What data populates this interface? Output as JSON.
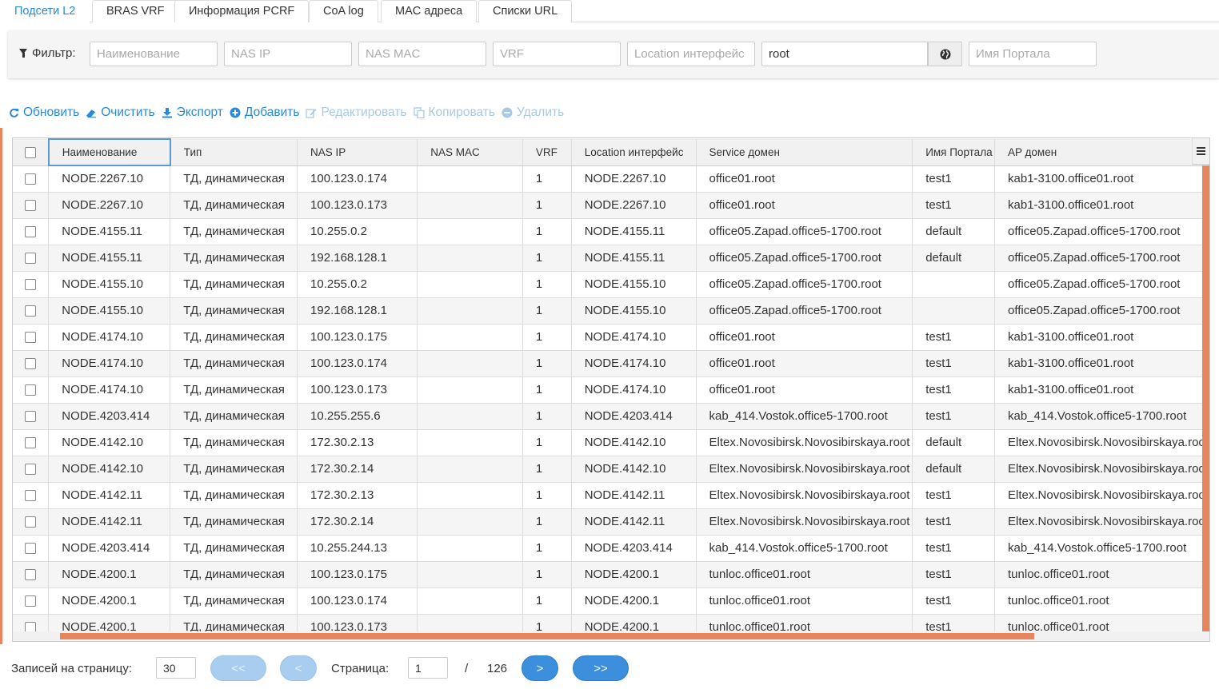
{
  "tabs": [
    {
      "label": "Подсети L2",
      "active": true
    },
    {
      "label": "BRAS VRF"
    },
    {
      "label": "Информация PCRF"
    },
    {
      "label": "CoA log"
    },
    {
      "label": "MAC адреса"
    },
    {
      "label": "Списки URL"
    }
  ],
  "filter": {
    "label": "Фильтр:",
    "name_placeholder": "Наименование",
    "nas_ip_placeholder": "NAS IP",
    "nas_mac_placeholder": "NAS MAC",
    "vrf_placeholder": "VRF",
    "location_placeholder": "Location интерфейс",
    "domain_value": "root",
    "portal_placeholder": "Имя Портала"
  },
  "toolbar": {
    "refresh": "Обновить",
    "clear": "Очистить",
    "export": "Экспорт",
    "add": "Добавить",
    "edit": "Редактировать",
    "copy": "Копировать",
    "delete": "Удалить"
  },
  "table": {
    "columns": [
      "Наименование",
      "Тип",
      "NAS IP",
      "NAS MAC",
      "VRF",
      "Location интерфейс",
      "Service домен",
      "Имя Портала",
      "AP домен"
    ],
    "rows": [
      [
        "NODE.2267.10",
        "ТД, динамическая",
        "100.123.0.174",
        "",
        "1",
        "NODE.2267.10",
        "office01.root",
        "test1",
        "kab1-3100.office01.root"
      ],
      [
        "NODE.2267.10",
        "ТД, динамическая",
        "100.123.0.173",
        "",
        "1",
        "NODE.2267.10",
        "office01.root",
        "test1",
        "kab1-3100.office01.root"
      ],
      [
        "NODE.4155.11",
        "ТД, динамическая",
        "10.255.0.2",
        "",
        "1",
        "NODE.4155.11",
        "office05.Zapad.office5-1700.root",
        "default",
        "office05.Zapad.office5-1700.root"
      ],
      [
        "NODE.4155.11",
        "ТД, динамическая",
        "192.168.128.1",
        "",
        "1",
        "NODE.4155.11",
        "office05.Zapad.office5-1700.root",
        "default",
        "office05.Zapad.office5-1700.root"
      ],
      [
        "NODE.4155.10",
        "ТД, динамическая",
        "10.255.0.2",
        "",
        "1",
        "NODE.4155.10",
        "office05.Zapad.office5-1700.root",
        "",
        "office05.Zapad.office5-1700.root"
      ],
      [
        "NODE.4155.10",
        "ТД, динамическая",
        "192.168.128.1",
        "",
        "1",
        "NODE.4155.10",
        "office05.Zapad.office5-1700.root",
        "",
        "office05.Zapad.office5-1700.root"
      ],
      [
        "NODE.4174.10",
        "ТД, динамическая",
        "100.123.0.175",
        "",
        "1",
        "NODE.4174.10",
        "office01.root",
        "test1",
        "kab1-3100.office01.root"
      ],
      [
        "NODE.4174.10",
        "ТД, динамическая",
        "100.123.0.174",
        "",
        "1",
        "NODE.4174.10",
        "office01.root",
        "test1",
        "kab1-3100.office01.root"
      ],
      [
        "NODE.4174.10",
        "ТД, динамическая",
        "100.123.0.173",
        "",
        "1",
        "NODE.4174.10",
        "office01.root",
        "test1",
        "kab1-3100.office01.root"
      ],
      [
        "NODE.4203.414",
        "ТД, динамическая",
        "10.255.255.6",
        "",
        "1",
        "NODE.4203.414",
        "kab_414.Vostok.office5-1700.root",
        "test1",
        "kab_414.Vostok.office5-1700.root"
      ],
      [
        "NODE.4142.10",
        "ТД, динамическая",
        "172.30.2.13",
        "",
        "1",
        "NODE.4142.10",
        "Eltex.Novosibirsk.Novosibirskaya.root",
        "default",
        "Eltex.Novosibirsk.Novosibirskaya.root"
      ],
      [
        "NODE.4142.10",
        "ТД, динамическая",
        "172.30.2.14",
        "",
        "1",
        "NODE.4142.10",
        "Eltex.Novosibirsk.Novosibirskaya.root",
        "default",
        "Eltex.Novosibirsk.Novosibirskaya.root"
      ],
      [
        "NODE.4142.11",
        "ТД, динамическая",
        "172.30.2.13",
        "",
        "1",
        "NODE.4142.11",
        "Eltex.Novosibirsk.Novosibirskaya.root",
        "test1",
        "Eltex.Novosibirsk.Novosibirskaya.root"
      ],
      [
        "NODE.4142.11",
        "ТД, динамическая",
        "172.30.2.14",
        "",
        "1",
        "NODE.4142.11",
        "Eltex.Novosibirsk.Novosibirskaya.root",
        "test1",
        "Eltex.Novosibirsk.Novosibirskaya.root"
      ],
      [
        "NODE.4203.414",
        "ТД, динамическая",
        "10.255.244.13",
        "",
        "1",
        "NODE.4203.414",
        "kab_414.Vostok.office5-1700.root",
        "test1",
        "kab_414.Vostok.office5-1700.root"
      ],
      [
        "NODE.4200.1",
        "ТД, динамическая",
        "100.123.0.175",
        "",
        "1",
        "NODE.4200.1",
        "tunloc.office01.root",
        "test1",
        "tunloc.office01.root"
      ],
      [
        "NODE.4200.1",
        "ТД, динамическая",
        "100.123.0.174",
        "",
        "1",
        "NODE.4200.1",
        "tunloc.office01.root",
        "test1",
        "tunloc.office01.root"
      ],
      [
        "NODE.4200.1",
        "ТД, динамическая",
        "100.123.0.173",
        "",
        "1",
        "NODE.4200.1",
        "tunloc.office01.root",
        "test1",
        "tunloc.office01.root"
      ]
    ]
  },
  "pager": {
    "per_page_label": "Записей на страницу:",
    "per_page_value": "30",
    "first": "<<",
    "prev": "<",
    "page_label": "Страница:",
    "page_value": "1",
    "separator": "/",
    "total_pages": "126",
    "next": ">",
    "last": ">>"
  },
  "colors": {
    "accent": "#2a8ad8",
    "scrollbar": "#e8845e"
  }
}
